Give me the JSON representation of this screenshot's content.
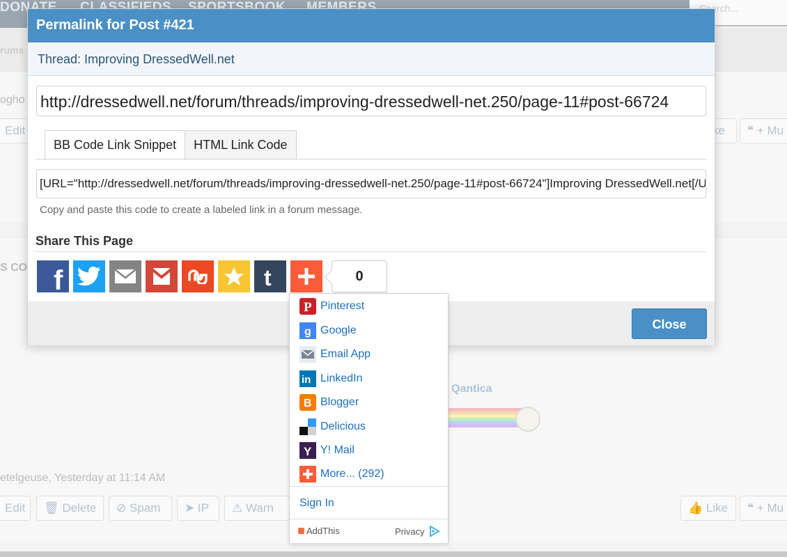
{
  "background": {
    "nav_items": [
      "DONATE",
      "CLASSIFIEDS",
      "SPORTSBOOK",
      "MEMBERS"
    ],
    "search_placeholder": "Search...",
    "breadcrumb_fragment": "rums",
    "post1_author_fragment": "ogho",
    "post1_edit": "Edit",
    "post1_like": "ke",
    "post1_quote": "+ Mu",
    "section_fragment": "S CO",
    "signature_name": "Qantica",
    "post2_meta": "etelgeuse, Yesterday at 11:14 AM",
    "post2_edit": "Edit",
    "post2_delete": "Delete",
    "post2_spam": "Spam",
    "post2_ip": "IP",
    "post2_warn": "Warn",
    "post2_like": "Like",
    "post2_quote": "+ Mu"
  },
  "modal": {
    "title": "Permalink for Post #421",
    "thread": "Thread: Improving DressedWell.net",
    "url": "http://dressedwell.net/forum/threads/improving-dressedwell-net.250/page-11#post-66724",
    "tabs": [
      "BB Code Link Snippet",
      "HTML Link Code"
    ],
    "bb_code": "[URL=\"http://dressedwell.net/forum/threads/improving-dressedwell-net.250/page-11#post-66724\"]Improving DressedWell.net[/URL]",
    "hint": "Copy and paste this code to create a labeled link in a forum message.",
    "share_title": "Share This Page",
    "share_count": "0",
    "close_label": "Close",
    "colors": {
      "header": "#4a90c6",
      "facebook": "#3b5998",
      "twitter": "#1da1f2",
      "email": "#848484",
      "gmail": "#d44638",
      "stumbleupon": "#eb4924",
      "favorites": "#f8c532",
      "tumblr": "#35465c",
      "addthis": "#fa5c3a"
    }
  },
  "dropdown": {
    "items": [
      {
        "label": "Pinterest",
        "icon": "pinterest-icon"
      },
      {
        "label": "Google",
        "icon": "google-icon"
      },
      {
        "label": "Email App",
        "icon": "email-app-icon"
      },
      {
        "label": "LinkedIn",
        "icon": "linkedin-icon"
      },
      {
        "label": "Blogger",
        "icon": "blogger-icon"
      },
      {
        "label": "Delicious",
        "icon": "delicious-icon"
      },
      {
        "label": "Y! Mail",
        "icon": "yahoo-mail-icon"
      },
      {
        "label": "More... (292)",
        "icon": "more-icon"
      }
    ],
    "sign_in": "Sign In",
    "brand": "AddThis",
    "privacy": "Privacy"
  }
}
